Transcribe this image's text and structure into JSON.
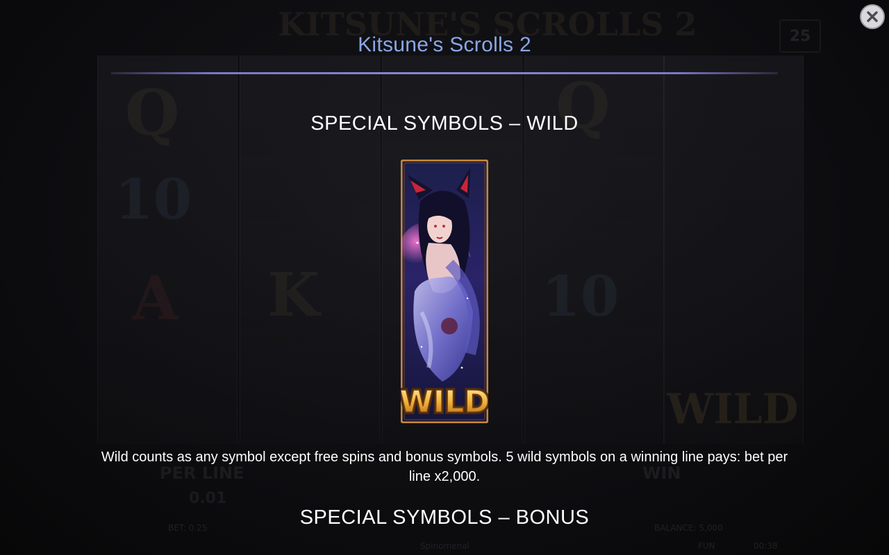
{
  "popup": {
    "title": "Kitsune's Scrolls 2",
    "close_icon": "close-icon"
  },
  "sections": [
    {
      "heading": "SPECIAL SYMBOLS – WILD",
      "symbol_label": "WILD",
      "description": "Wild counts as any symbol except free spins and bonus symbols. 5 wild symbols on a winning line pays: bet per line x2,000."
    },
    {
      "heading": "SPECIAL SYMBOLS – BONUS"
    }
  ],
  "background_game": {
    "logo_text": "KITSUNE'S SCROLLS 2",
    "lines_badge": "25",
    "per_line_label": "PER LINE",
    "per_line_value": "0.01",
    "win_label": "WIN",
    "bet_text": "BET: 0.25",
    "balance_text": "BALANCE: 5,000",
    "fun_text": "FUN",
    "clock_text": "00:38",
    "brand_text": "Spinomenal",
    "reel_wild_text": "WILD"
  },
  "colors": {
    "title": "#8aa7e6",
    "divider": "#8c87d4",
    "text": "#ffffff",
    "wild_gold": "#f0b23a",
    "card_border": "#c8873a"
  }
}
